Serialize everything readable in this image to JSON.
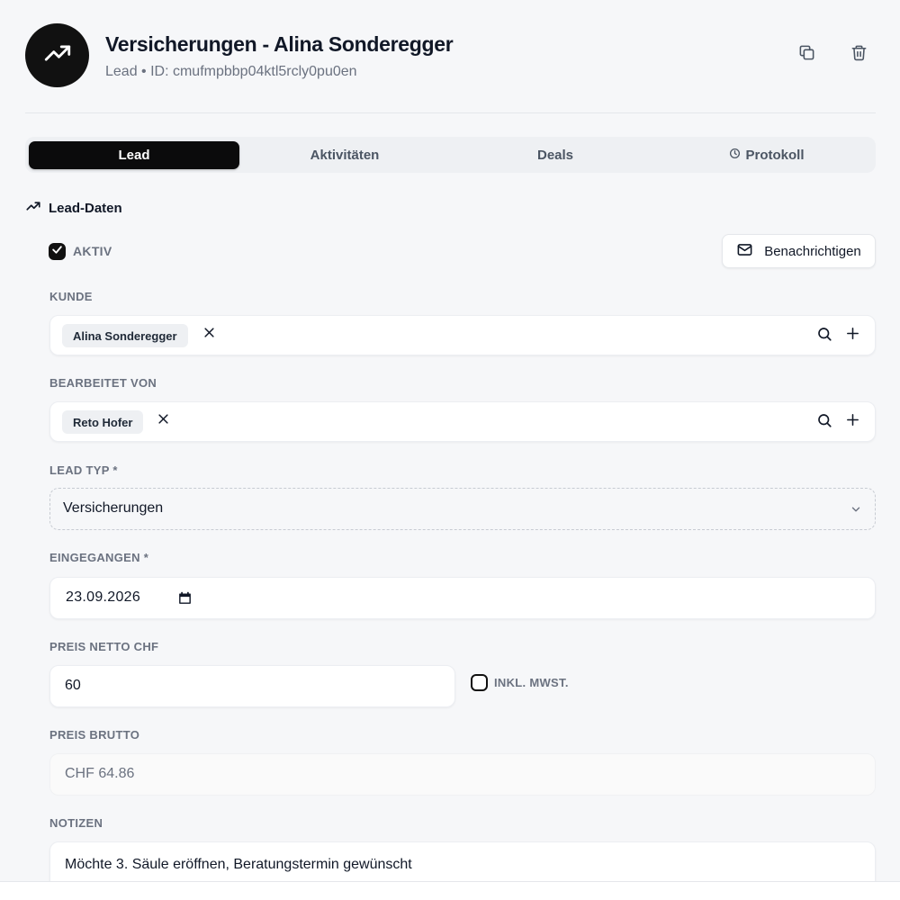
{
  "header": {
    "title": "Versicherungen - Alina Sonderegger",
    "subtitle": "Lead • ID: cmufmpbbp04ktl5rcly0pu0en",
    "avatar_icon": "trending-up-icon",
    "actions": [
      {
        "icon": "copy-icon"
      },
      {
        "icon": "trash-icon"
      }
    ]
  },
  "tabs": [
    {
      "label": "Lead",
      "active": true
    },
    {
      "label": "Aktivitäten",
      "active": false
    },
    {
      "label": "Deals",
      "active": false
    },
    {
      "label": "Protokoll",
      "active": false,
      "icon": "clock-icon"
    }
  ],
  "section": {
    "title": "Lead-Daten",
    "icon": "trending-up-icon"
  },
  "form": {
    "aktiv": {
      "label": "AKTIV",
      "checked": true
    },
    "notify_button": {
      "label": "Benachrichtigen",
      "icon": "mail-icon"
    },
    "kunde": {
      "label": "KUNDE",
      "value": "Alina Sonderegger"
    },
    "bearbeitet_von": {
      "label": "BEARBEITET VON",
      "value": "Reto Hofer"
    },
    "lead_typ": {
      "label": "LEAD TYP *",
      "value": "Versicherungen"
    },
    "eingegangen": {
      "label": "EINGEGANGEN *",
      "value": "23.09.2026",
      "icon": "calendar-icon"
    },
    "preis_netto": {
      "label": "PREIS NETTO CHF",
      "value": "60"
    },
    "inkl_mwst": {
      "label": "INKL. MWST.",
      "checked": false
    },
    "preis_brutto": {
      "label": "PREIS BRUTTO",
      "value": "CHF 64.86"
    },
    "notizen": {
      "label": "NOTIZEN",
      "value": "Möchte 3. Säule eröffnen, Beratungstermin gewünscht"
    }
  },
  "colors": {
    "accent": "#0b0b0c",
    "background": "#f6f7f9",
    "muted_text": "#6b7280"
  }
}
